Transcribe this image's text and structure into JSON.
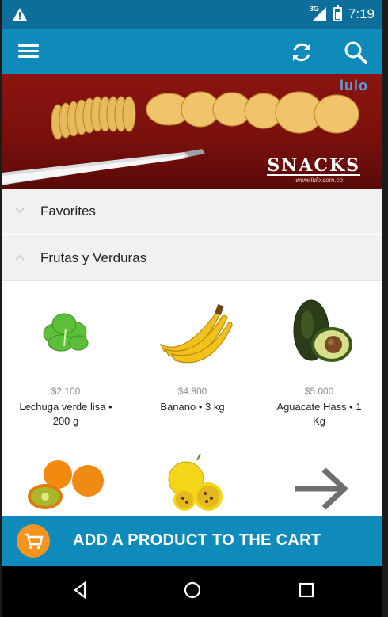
{
  "status_bar": {
    "time": "7:19",
    "network": "3G",
    "icons": [
      "warning-icon",
      "signal-icon",
      "battery-icon"
    ]
  },
  "toolbar": {
    "icons": [
      "menu-icon",
      "refresh-icon",
      "search-icon"
    ]
  },
  "banner": {
    "brand": "lulo",
    "headline": "SNACKS",
    "url": "www.lulo.com.co"
  },
  "categories": [
    {
      "label": "Favorites",
      "state": "collapsed"
    },
    {
      "label": "Frutas y Verduras",
      "state": "expanded"
    }
  ],
  "products": [
    {
      "price": "$2.100",
      "name": "Lechuga verde lisa • 200 g",
      "icon": "lettuce-image"
    },
    {
      "price": "$4.800",
      "name": "Banano • 3 kg",
      "icon": "banana-image"
    },
    {
      "price": "$5.000",
      "name": "Aguacate Hass • 1 Kg",
      "icon": "avocado-image"
    },
    {
      "icon": "lulo-image"
    },
    {
      "icon": "passion-fruit-image"
    },
    {
      "icon": "arrow-right-icon"
    }
  ],
  "cart_bar": {
    "label": "ADD A PRODUCT TO THE CART",
    "icon": "cart-icon"
  },
  "nav_bar": {
    "icons": [
      "back-icon",
      "home-icon",
      "recents-icon"
    ]
  },
  "colors": {
    "status_bar": "#0d6f99",
    "toolbar": "#0e8bbb",
    "cart_bar": "#0e8bbb",
    "cart_icon_bg": "#f7941d",
    "banner_bg": "#7a100c"
  }
}
